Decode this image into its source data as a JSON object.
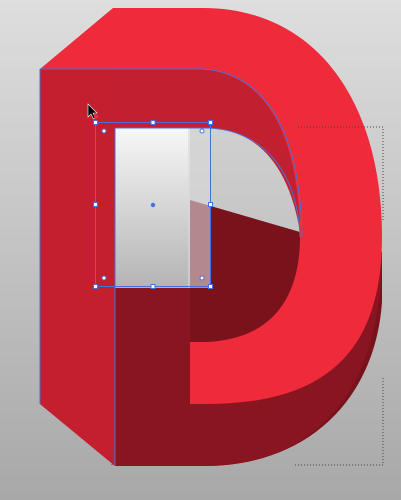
{
  "colors": {
    "background_top": "#dedede",
    "background_bottom": "#a8a8a8",
    "front_face": "#ee2a3b",
    "left_face": "#c41f2e",
    "inner_top_face": "#c22030",
    "bottom_face": "#881520",
    "shadow_face": "#7a121c",
    "inner_gradient_top": "#f7f7f7",
    "inner_gradient_bottom": "#b4b4b4",
    "selection": "#4a6fd8",
    "guide": "#444444"
  },
  "icons": {
    "cursor": "arrow-cursor-icon"
  },
  "selection": {
    "visible": true
  }
}
